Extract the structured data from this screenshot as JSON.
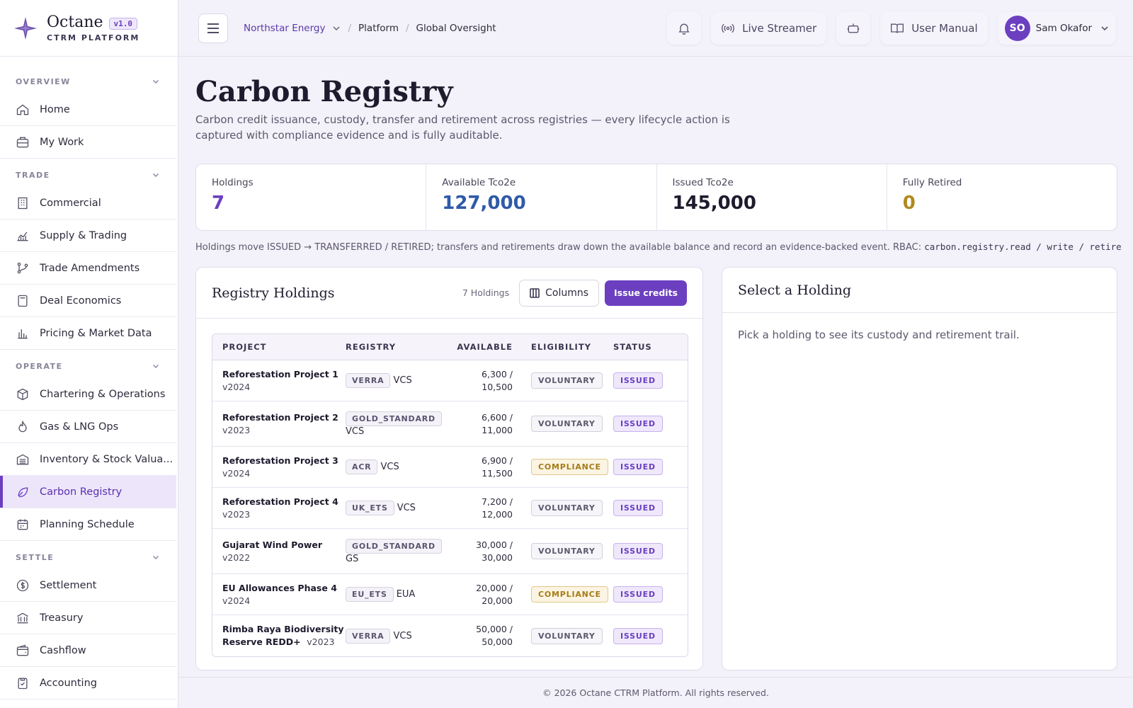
{
  "brand": {
    "name": "Octane",
    "version": "v1.0",
    "subtitle": "CTRM PLATFORM"
  },
  "sidebar": {
    "sections": [
      {
        "label": "OVERVIEW",
        "items": [
          {
            "label": "Home",
            "icon": "home-icon"
          },
          {
            "label": "My Work",
            "icon": "briefcase-icon"
          }
        ]
      },
      {
        "label": "TRADE",
        "items": [
          {
            "label": "Commercial",
            "icon": "building-icon"
          },
          {
            "label": "Supply & Trading",
            "icon": "chart-line-icon"
          },
          {
            "label": "Trade Amendments",
            "icon": "git-branch-icon"
          },
          {
            "label": "Deal Economics",
            "icon": "calculator-icon"
          },
          {
            "label": "Pricing & Market Data",
            "icon": "bar-chart-icon"
          }
        ]
      },
      {
        "label": "OPERATE",
        "items": [
          {
            "label": "Chartering & Operations",
            "icon": "package-icon"
          },
          {
            "label": "Gas & LNG Ops",
            "icon": "flame-icon"
          },
          {
            "label": "Inventory & Stock Valua...",
            "icon": "warehouse-icon"
          },
          {
            "label": "Carbon Registry",
            "icon": "leaf-icon",
            "active": true
          },
          {
            "label": "Planning Schedule",
            "icon": "calendar-icon"
          }
        ]
      },
      {
        "label": "SETTLE",
        "items": [
          {
            "label": "Settlement",
            "icon": "dollar-icon"
          },
          {
            "label": "Treasury",
            "icon": "bank-icon"
          },
          {
            "label": "Cashflow",
            "icon": "wallet-icon"
          },
          {
            "label": "Accounting",
            "icon": "clipboard-icon"
          }
        ]
      }
    ]
  },
  "header": {
    "org": "Northstar Energy",
    "crumbs": [
      "Platform",
      "Global Oversight"
    ],
    "live_streamer": "Live Streamer",
    "user_manual": "User Manual",
    "user_initials": "SO",
    "user_name": "Sam Okafor"
  },
  "page": {
    "title": "Carbon Registry",
    "description": "Carbon credit issuance, custody, transfer and retirement across registries — every lifecycle action is captured with compliance evidence and is fully auditable.",
    "note_text": "Holdings move ISSUED → TRANSFERRED / RETIRED; transfers and retirements draw down the available balance and record an evidence-backed event. RBAC:",
    "note_code": "carbon.registry.read / write / retire"
  },
  "stats": [
    {
      "label": "Holdings",
      "value": "7",
      "color": "#6a3fc0"
    },
    {
      "label": "Available Tco2e",
      "value": "127,000",
      "color": "#2f5aa8"
    },
    {
      "label": "Issued Tco2e",
      "value": "145,000",
      "color": "#1f1b2e"
    },
    {
      "label": "Fully Retired",
      "value": "0",
      "color": "#b08a1e"
    }
  ],
  "holdings": {
    "title": "Registry Holdings",
    "count": "7 Holdings",
    "columns_label": "Columns",
    "issue_label": "Issue credits",
    "headers": [
      "PROJECT",
      "REGISTRY",
      "AVAILABLE",
      "ELIGIBILITY",
      "STATUS"
    ],
    "rows": [
      {
        "project": "Reforestation Project 1",
        "vintage": "v2024",
        "registry": "VERRA",
        "standard": "VCS",
        "available": "6,300 /",
        "total": "10,500",
        "eligibility": "VOLUNTARY",
        "status": "ISSUED"
      },
      {
        "project": "Reforestation Project 2",
        "vintage": "v2023",
        "registry": "GOLD_STANDARD",
        "standard": "VCS",
        "available": "6,600 /",
        "total": "11,000",
        "eligibility": "VOLUNTARY",
        "status": "ISSUED"
      },
      {
        "project": "Reforestation Project 3",
        "vintage": "v2024",
        "registry": "ACR",
        "standard": "VCS",
        "available": "6,900 /",
        "total": "11,500",
        "eligibility": "COMPLIANCE",
        "status": "ISSUED"
      },
      {
        "project": "Reforestation Project 4",
        "vintage": "v2023",
        "registry": "UK_ETS",
        "standard": "VCS",
        "available": "7,200 /",
        "total": "12,000",
        "eligibility": "VOLUNTARY",
        "status": "ISSUED"
      },
      {
        "project": "Gujarat Wind Power",
        "vintage": "v2022",
        "registry": "GOLD_STANDARD",
        "standard": "GS",
        "available": "30,000 /",
        "total": "30,000",
        "eligibility": "VOLUNTARY",
        "status": "ISSUED"
      },
      {
        "project": "EU Allowances Phase 4",
        "vintage": "v2024",
        "registry": "EU_ETS",
        "standard": "EUA",
        "available": "20,000 /",
        "total": "20,000",
        "eligibility": "COMPLIANCE",
        "status": "ISSUED"
      },
      {
        "project": "Rimba Raya Biodiversity Reserve REDD+",
        "vintage": "v2023",
        "registry": "VERRA",
        "standard": "VCS",
        "available": "50,000 /",
        "total": "50,000",
        "eligibility": "VOLUNTARY",
        "status": "ISSUED"
      }
    ]
  },
  "select_panel": {
    "title": "Select a Holding",
    "body": "Pick a holding to see its custody and retirement trail."
  },
  "footer": "© 2026 Octane CTRM Platform. All rights reserved."
}
